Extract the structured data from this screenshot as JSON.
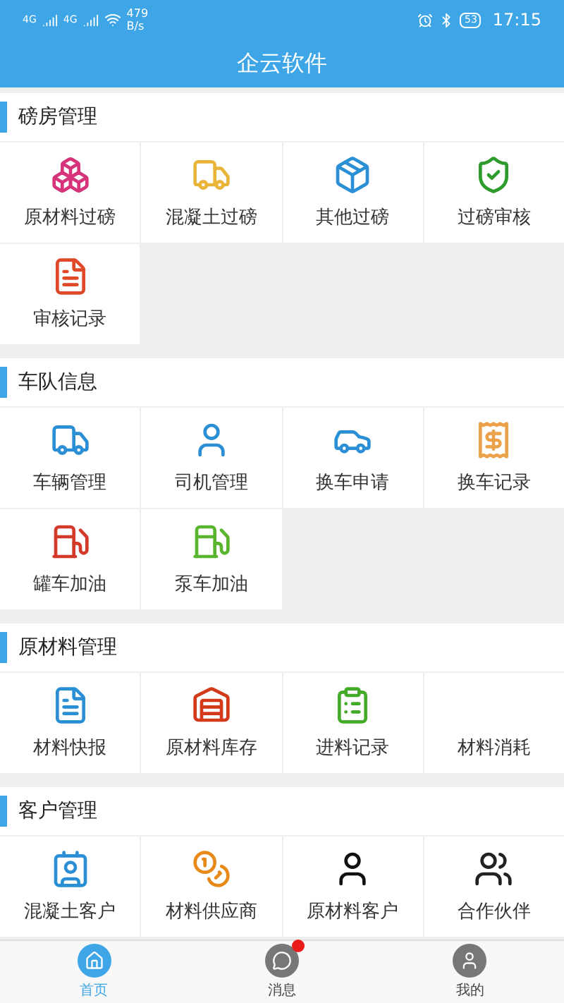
{
  "status_bar": {
    "network_1": "4G",
    "network_2": "4G",
    "speed": "479",
    "speed_unit": "B/s",
    "battery": "53",
    "time": "17:15"
  },
  "header": {
    "title": "企云软件"
  },
  "sections": [
    {
      "title": "磅房管理",
      "items": [
        {
          "label": "原材料过磅"
        },
        {
          "label": "混凝土过磅"
        },
        {
          "label": "其他过磅"
        },
        {
          "label": "过磅审核"
        },
        {
          "label": "审核记录"
        }
      ]
    },
    {
      "title": "车队信息",
      "items": [
        {
          "label": "车辆管理"
        },
        {
          "label": "司机管理"
        },
        {
          "label": "换车申请"
        },
        {
          "label": "换车记录"
        },
        {
          "label": "罐车加油"
        },
        {
          "label": "泵车加油"
        }
      ]
    },
    {
      "title": "原材料管理",
      "items": [
        {
          "label": "材料快报"
        },
        {
          "label": "原材料库存"
        },
        {
          "label": "进料记录"
        },
        {
          "label": "材料消耗"
        }
      ]
    },
    {
      "title": "客户管理",
      "items": [
        {
          "label": "混凝土客户"
        },
        {
          "label": "材料供应商"
        },
        {
          "label": "原材料客户"
        },
        {
          "label": "合作伙伴"
        }
      ]
    }
  ],
  "tab_bar": [
    {
      "label": "首页",
      "selected": true,
      "badge": false
    },
    {
      "label": "消息",
      "selected": false,
      "badge": true
    },
    {
      "label": "我的",
      "selected": false,
      "badge": false
    }
  ]
}
